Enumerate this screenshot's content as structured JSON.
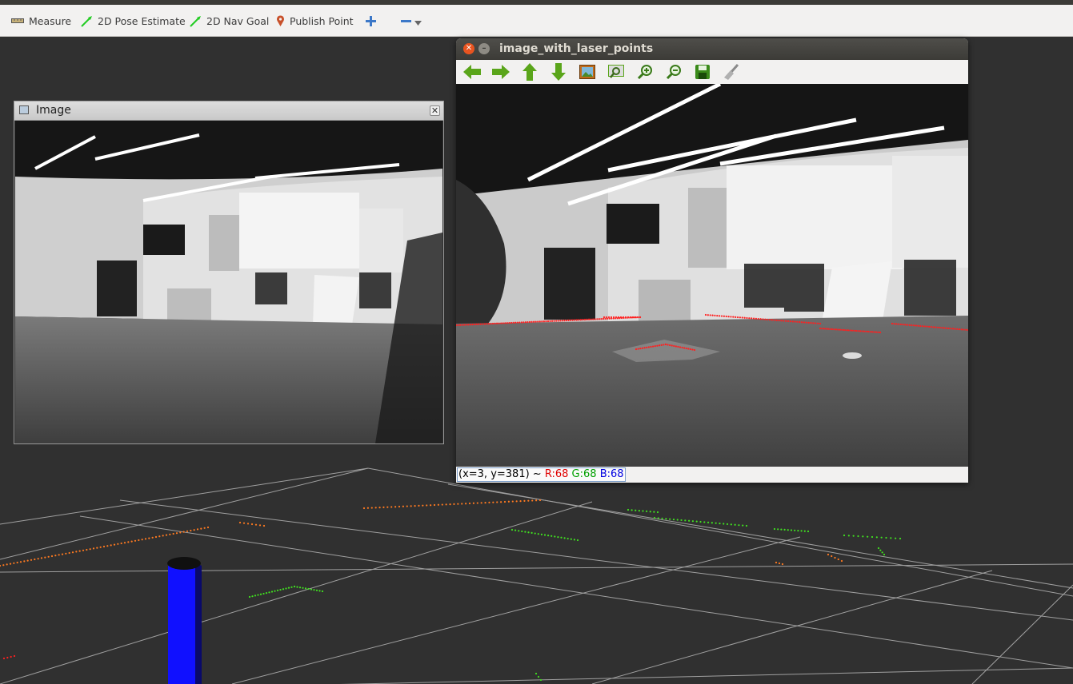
{
  "toolbar": {
    "measure_label": "Measure",
    "pose_estimate_label": "2D Pose Estimate",
    "nav_goal_label": "2D Nav Goal",
    "publish_point_label": "Publish Point"
  },
  "image_panel": {
    "title": "Image"
  },
  "laser_window": {
    "title": "image_with_laser_points",
    "status": {
      "coords": "(x=3, y=381) ~",
      "r": "R:68",
      "g": "G:68",
      "b": "B:68"
    }
  },
  "colors": {
    "viewport_bg": "#303030",
    "grid_line": "#a0a0a0",
    "laser_red": "#ff2020",
    "laser_green": "#40e020",
    "laser_orange": "#ff7a20",
    "cylinder_blue": "#1010ff",
    "status_r": "#e00000",
    "status_g": "#00a000",
    "status_b": "#0000e0"
  }
}
